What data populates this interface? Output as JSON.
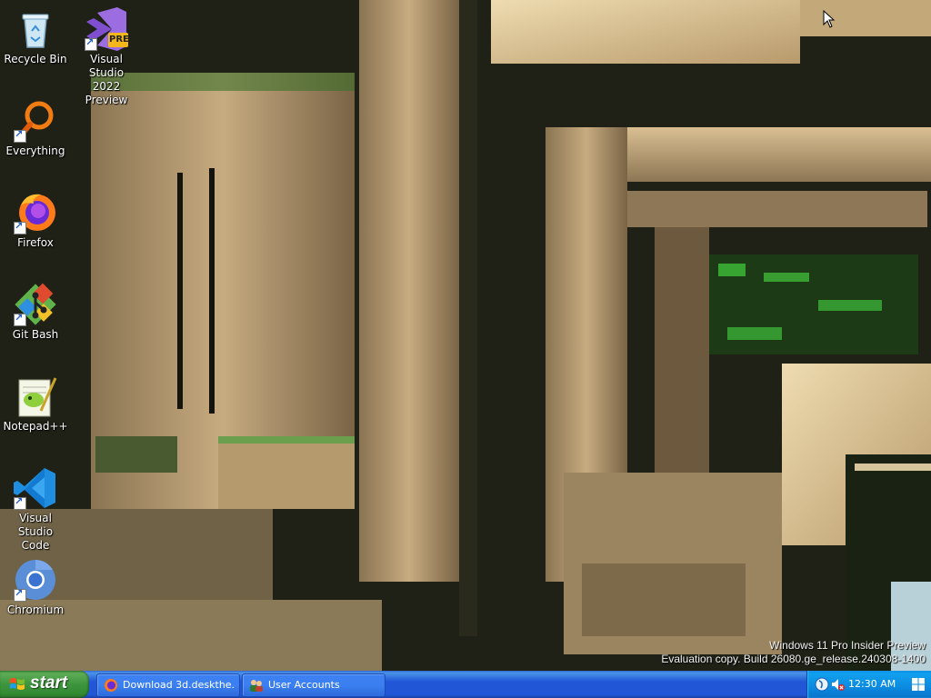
{
  "desktop": {
    "icons": [
      {
        "label": "Recycle Bin",
        "icon": "recycle-bin-icon"
      },
      {
        "label": "Visual Studio\n2022 Preview",
        "icon": "visual-studio-preview-icon",
        "badge": "PRE"
      },
      {
        "label": "Everything",
        "icon": "everything-search-icon"
      },
      {
        "label": "Firefox",
        "icon": "firefox-icon"
      },
      {
        "label": "Git Bash",
        "icon": "git-bash-icon"
      },
      {
        "label": "Notepad++",
        "icon": "notepad-plus-plus-icon"
      },
      {
        "label": "Visual Studio\nCode",
        "icon": "vscode-icon"
      },
      {
        "label": "Chromium",
        "icon": "chromium-icon"
      }
    ]
  },
  "watermark": {
    "line1": "Windows 11 Pro Insider Preview",
    "line2": "Evaluation copy. Build 26080.ge_release.240308-1400"
  },
  "taskbar": {
    "start_label": "start",
    "tasks": [
      {
        "label": "Download 3d.deskthe...",
        "icon": "firefox-icon"
      },
      {
        "label": "User Accounts",
        "icon": "user-accounts-icon"
      }
    ],
    "tray": {
      "icons": [
        "network-globe-icon",
        "volume-muted-icon"
      ],
      "clock": "12:30 AM"
    }
  },
  "colors": {
    "taskbar_blue": "#2157d7",
    "start_green": "#3d953d",
    "tray_blue": "#0b8be0"
  }
}
